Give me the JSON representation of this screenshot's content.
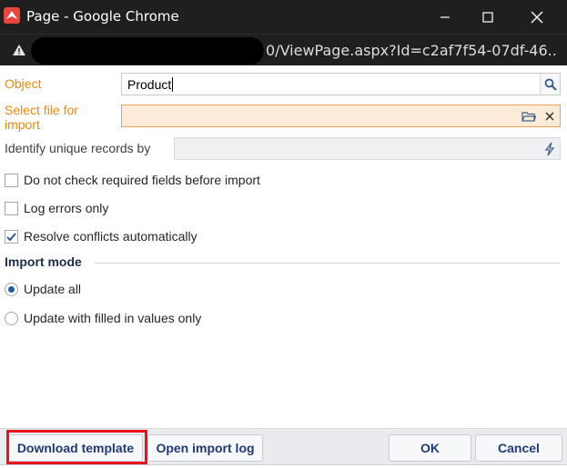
{
  "window": {
    "title": "Page - Google Chrome",
    "url_visible": "0/ViewPage.aspx?Id=c2af7f54-07df-46..."
  },
  "form": {
    "object_label": "Object",
    "object_value": "Product",
    "file_label": "Select file for import",
    "file_value": "",
    "identify_label": "Identify unique records by",
    "identify_value": ""
  },
  "options": [
    {
      "label": "Do not check required fields before import",
      "checked": false
    },
    {
      "label": "Log errors only",
      "checked": false
    },
    {
      "label": "Resolve conflicts automatically",
      "checked": true
    }
  ],
  "import_mode": {
    "title": "Import mode",
    "choices": [
      {
        "label": "Update all",
        "selected": true
      },
      {
        "label": "Update with filled in values only",
        "selected": false
      }
    ]
  },
  "footer": {
    "download_template": "Download template",
    "open_import_log": "Open import log",
    "ok": "OK",
    "cancel": "Cancel"
  },
  "colors": {
    "accent": "#1f3b73",
    "required_label": "#e8890d",
    "highlight": "#e8141c"
  }
}
